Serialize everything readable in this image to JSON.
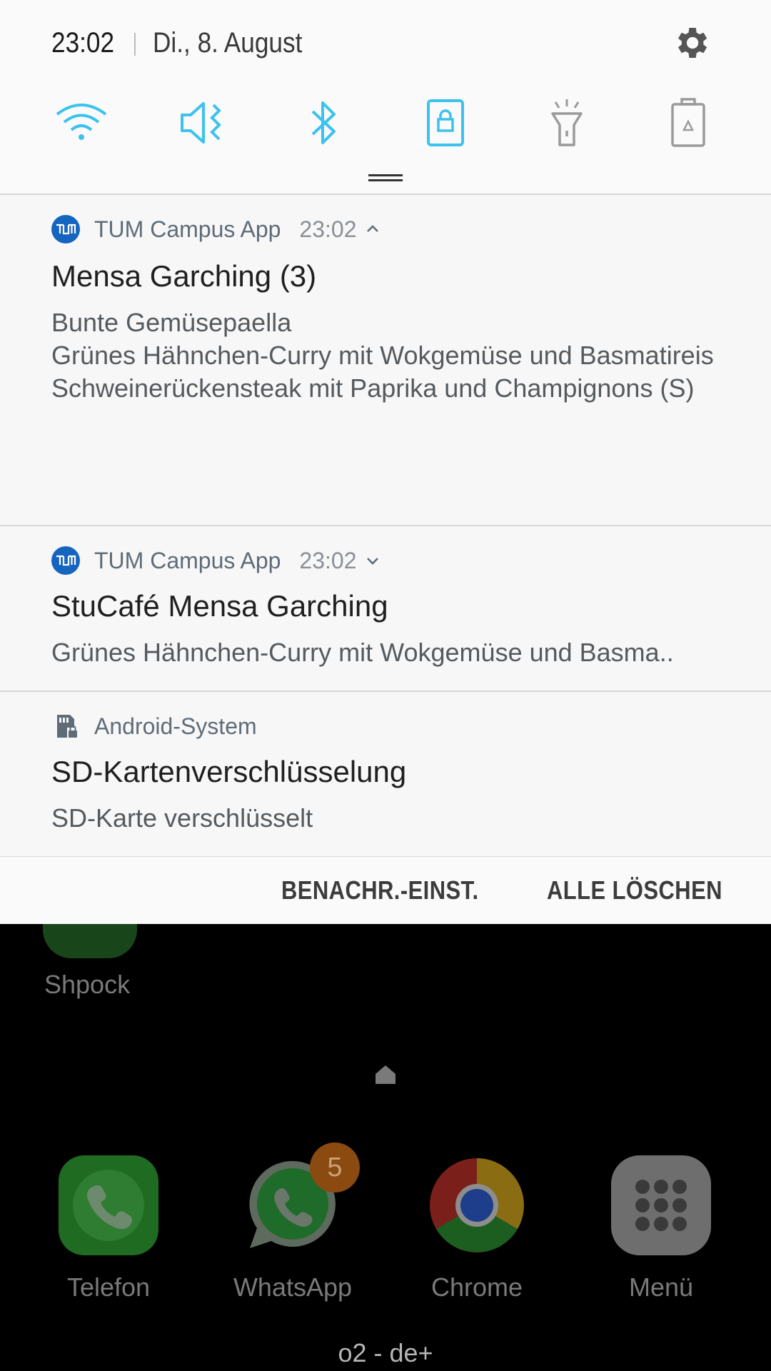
{
  "status": {
    "time": "23:02",
    "date": "Di., 8. August"
  },
  "quick_settings": {
    "tiles": [
      {
        "icon": "wifi-icon",
        "active": true
      },
      {
        "icon": "mute-icon",
        "active": true
      },
      {
        "icon": "bluetooth-icon",
        "active": true
      },
      {
        "icon": "screen-lock-icon",
        "active": true
      },
      {
        "icon": "flashlight-icon",
        "active": false
      },
      {
        "icon": "power-saving-icon",
        "active": false
      }
    ],
    "accent_color": "#3cc2ee"
  },
  "notifications": [
    {
      "app": "TUM Campus App",
      "time": "23:02",
      "title": "Mensa Garching (3)",
      "lines": [
        "Bunte Gemüsepaella",
        "Grünes Hähnchen-Curry mit Wokgemüse und Basmatireis",
        "Schweinerückensteak mit Paprika und Champignons (S)"
      ],
      "expanded": true
    },
    {
      "app": "TUM Campus App",
      "time": "23:02",
      "title": "StuCafé Mensa Garching",
      "text": "Grünes Hähnchen-Curry mit Wokgemüse und Basma..",
      "expanded": false
    },
    {
      "app": "Android-System",
      "title": "SD-Kartenverschlüsselung",
      "text": "SD-Karte verschlüsselt"
    }
  ],
  "actions": {
    "settings": "BENACHR.-EINST.",
    "clear_all": "ALLE LÖSCHEN"
  },
  "home": {
    "partial_app": "Shpock",
    "dock": [
      {
        "label": "Telefon",
        "icon": "phone-icon"
      },
      {
        "label": "WhatsApp",
        "icon": "whatsapp-icon",
        "badge": "5"
      },
      {
        "label": "Chrome",
        "icon": "chrome-icon"
      },
      {
        "label": "Menü",
        "icon": "apps-grid-icon"
      }
    ],
    "carrier": "o2 - de+"
  }
}
